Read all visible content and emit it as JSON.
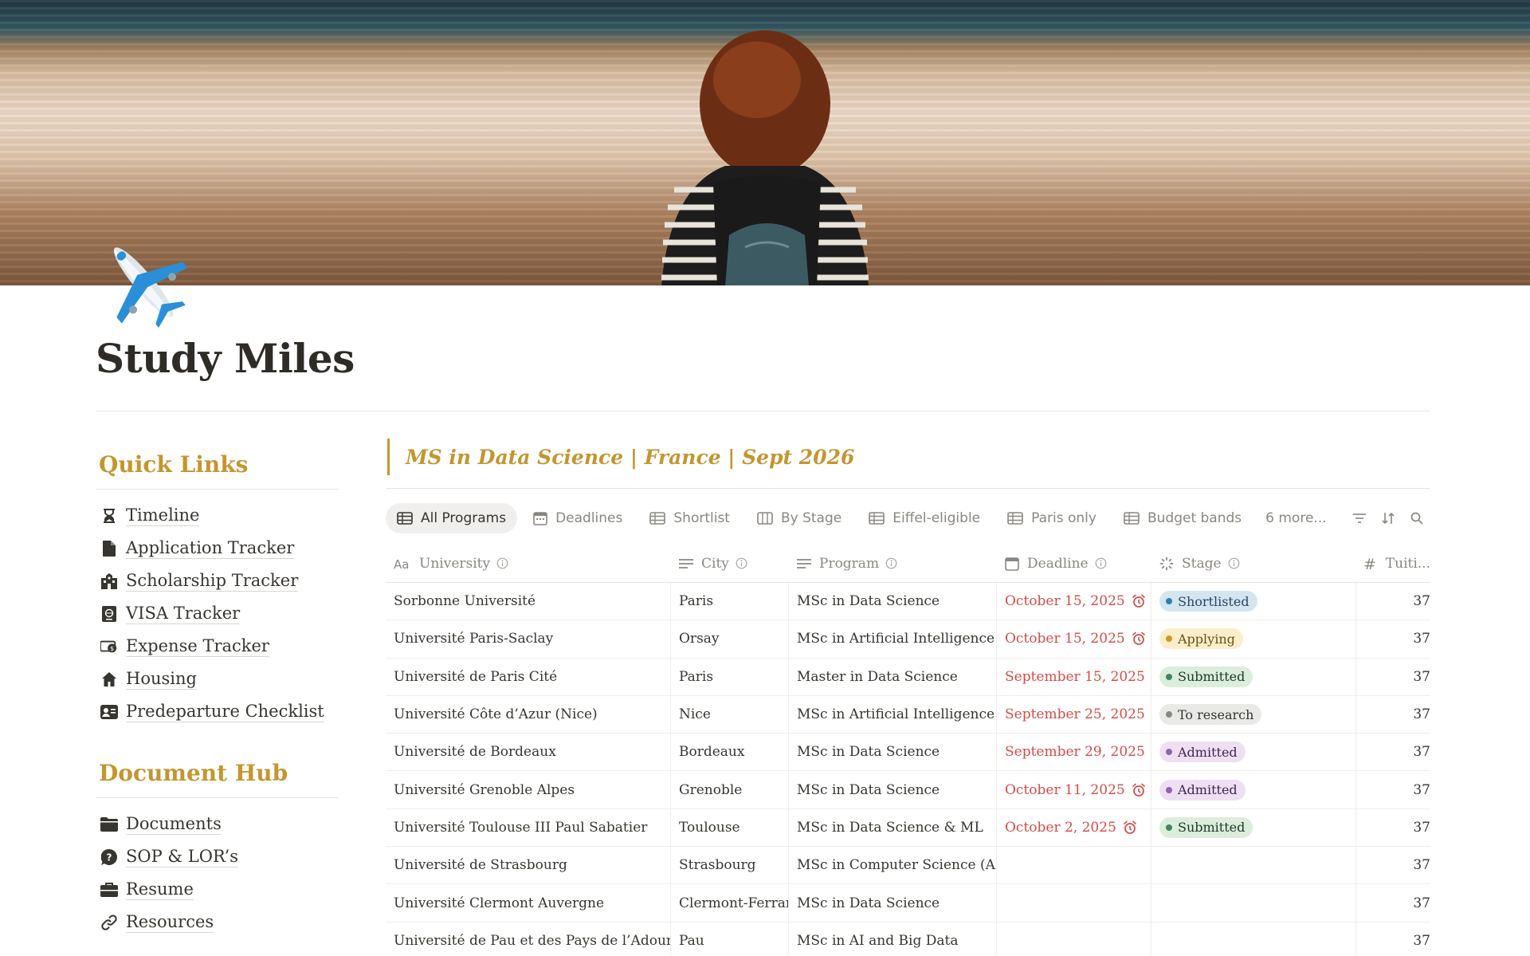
{
  "page": {
    "title": "Study Miles"
  },
  "sidebar": {
    "quick_links": {
      "heading": "Quick Links",
      "items": [
        {
          "label": "Timeline",
          "icon": "hourglass-icon"
        },
        {
          "label": "Application Tracker",
          "icon": "document-icon"
        },
        {
          "label": "Scholarship Tracker",
          "icon": "school-icon"
        },
        {
          "label": "VISA Tracker",
          "icon": "passport-icon"
        },
        {
          "label": "Expense Tracker",
          "icon": "money-icon"
        },
        {
          "label": "Housing",
          "icon": "house-icon"
        },
        {
          "label": "Predeparture Checklist",
          "icon": "checklist-icon"
        }
      ]
    },
    "document_hub": {
      "heading": "Document Hub",
      "items": [
        {
          "label": "Documents",
          "icon": "folder-icon"
        },
        {
          "label": "SOP & LOR’s",
          "icon": "question-bubble-icon"
        },
        {
          "label": "Resume",
          "icon": "briefcase-icon"
        },
        {
          "label": "Resources",
          "icon": "link-icon"
        }
      ]
    }
  },
  "database": {
    "title": "MS in Data Science | France | Sept 2026",
    "views": [
      {
        "label": "All Programs",
        "active": true
      },
      {
        "label": "Deadlines",
        "active": false
      },
      {
        "label": "Shortlist",
        "active": false
      },
      {
        "label": "By Stage",
        "active": false
      },
      {
        "label": "Eiffel-eligible",
        "active": false
      },
      {
        "label": "Paris only",
        "active": false
      },
      {
        "label": "Budget bands",
        "active": false
      }
    ],
    "more_views": "6 more...",
    "columns": {
      "university": "University",
      "city": "City",
      "program": "Program",
      "deadline": "Deadline",
      "stage": "Stage",
      "tuition": "Tuiti..."
    },
    "rows": [
      {
        "university": "Sorbonne Université",
        "city": "Paris",
        "program": "MSc in Data Science",
        "deadline": "October 15, 2025",
        "deadline_icon": "alarm",
        "stage": "Shortlisted",
        "tuition": "37"
      },
      {
        "university": "Université Paris-Saclay",
        "city": "Orsay",
        "program": "MSc in Artificial Intelligence",
        "deadline": "October 15, 2025",
        "deadline_icon": "alarm",
        "stage": "Applying",
        "tuition": "37"
      },
      {
        "university": "Université de Paris Cité",
        "city": "Paris",
        "program": "Master in Data Science",
        "deadline": "September 15, 2025",
        "deadline_icon": "arrow",
        "stage": "Submitted",
        "tuition": "37"
      },
      {
        "university": "Université Côte d’Azur (Nice)",
        "city": "Nice",
        "program": "MSc in Artificial Intelligence",
        "deadline": "September 25, 2025",
        "deadline_icon": "alarm",
        "stage": "To research",
        "tuition": "37"
      },
      {
        "university": "Université de Bordeaux",
        "city": "Bordeaux",
        "program": "MSc in Data Science",
        "deadline": "September 29, 2025",
        "deadline_icon": "alarm",
        "stage": "Admitted",
        "tuition": "37"
      },
      {
        "university": "Université Grenoble Alpes",
        "city": "Grenoble",
        "program": "MSc in Data Science",
        "deadline": "October 11, 2025",
        "deadline_icon": "alarm",
        "stage": "Admitted",
        "tuition": "37"
      },
      {
        "university": "Université Toulouse III Paul Sabatier",
        "city": "Toulouse",
        "program": "MSc in Data Science & ML",
        "deadline": "October 2, 2025",
        "deadline_icon": "alarm",
        "stage": "Submitted",
        "tuition": "37"
      },
      {
        "university": "Université de Strasbourg",
        "city": "Strasbourg",
        "program": "MSc in Computer Science (AI tra",
        "deadline": "",
        "deadline_icon": "",
        "stage": "",
        "tuition": "37"
      },
      {
        "university": "Université Clermont Auvergne",
        "city": "Clermont-Ferrand",
        "program": "MSc in Data Science",
        "deadline": "",
        "deadline_icon": "",
        "stage": "",
        "tuition": "37"
      },
      {
        "university": "Université de Pau et des Pays de l’Adour",
        "city": "Pau",
        "program": "MSc in AI and Big Data",
        "deadline": "",
        "deadline_icon": "",
        "stage": "",
        "tuition": "37"
      }
    ],
    "stage_colors": {
      "Shortlisted": {
        "bg": "#d3e5ef",
        "fg": "#28456c",
        "dot": "#337ea9"
      },
      "Applying": {
        "bg": "#fbeecc",
        "fg": "#6b4f13",
        "dot": "#cb9b1b"
      },
      "Submitted": {
        "bg": "#dbeddb",
        "fg": "#1c3829",
        "dot": "#448361"
      },
      "To research": {
        "bg": "#e9e9e7",
        "fg": "#37352f",
        "dot": "#8a8780"
      },
      "Admitted": {
        "bg": "#eee0f2",
        "fg": "#412454",
        "dot": "#9065b0"
      }
    },
    "accent_color": "#c4962f",
    "deadline_color": "#d44c47"
  }
}
